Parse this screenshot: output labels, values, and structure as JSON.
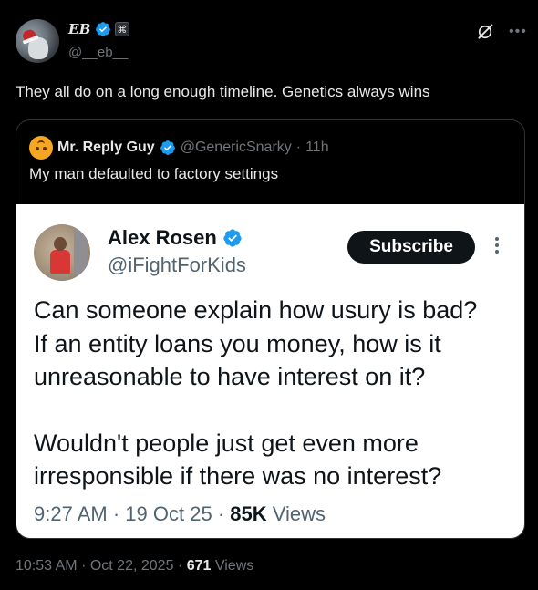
{
  "author": {
    "display_name": "EB",
    "handle": "@__eb__",
    "badge_symbol": "⌘"
  },
  "tweet": {
    "text": "They all do on a long enough timeline. Genetics always wins",
    "time": "10:53 AM",
    "sep": "·",
    "date": "Oct 22, 2025",
    "views_count": "671",
    "views_label": "Views"
  },
  "quote": {
    "display_name": "Mr. Reply Guy",
    "handle": "@GenericSnarky",
    "sep": "·",
    "age": "11h",
    "text": "My man defaulted to factory settings"
  },
  "embedded": {
    "display_name": "Alex Rosen",
    "handle": "@iFightForKids",
    "subscribe_label": "Subscribe",
    "paragraph1": [
      "Can someone explain how usury is bad?",
      "If an entity loans you money, how is it",
      "unreasonable to have interest on it?"
    ],
    "paragraph2": [
      "Wouldn't people just get even more",
      "irresponsible if there was no interest?"
    ],
    "time": "9:27 AM",
    "sep": "·",
    "date": "19 Oct 25",
    "views_count": "85K",
    "views_label": "Views"
  },
  "icons": {
    "verified": "verified-badge-icon",
    "grok": "grok-icon",
    "more": "more-icon"
  },
  "colors": {
    "background": "#000000",
    "text_primary": "#e7e9ea",
    "text_secondary": "#71767b",
    "verified_blue": "#1d9bf0",
    "border": "#2f3336"
  }
}
